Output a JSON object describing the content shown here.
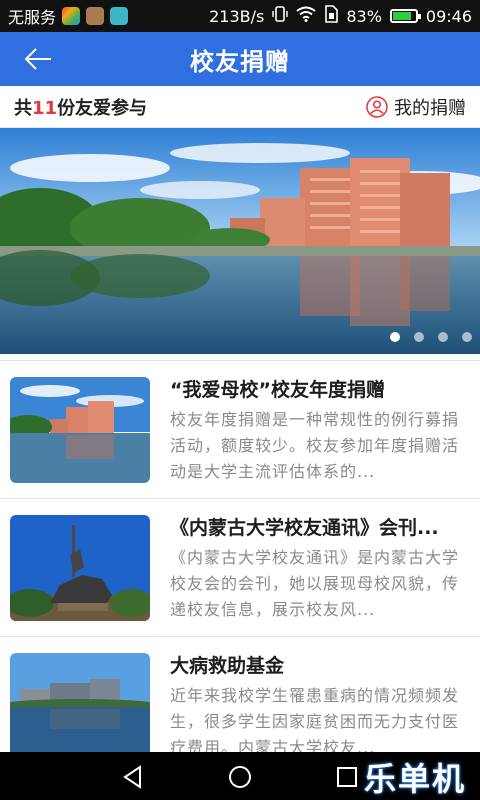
{
  "status_bar": {
    "carrier": "无服务",
    "speed": "213B/s",
    "battery_percent": "83%",
    "battery_level": 0.83,
    "time": "09:46"
  },
  "header": {
    "title": "校友捐赠",
    "back_icon": "arrow-left-icon"
  },
  "info_bar": {
    "prefix": "共",
    "count": "11",
    "suffix": "份友爱参与",
    "my_donation_label": "我的捐赠",
    "my_donation_icon": "user-icon"
  },
  "banner": {
    "slide_count": 4,
    "active_index": 0
  },
  "items": [
    {
      "title": "“我爱母校”校友年度捐赠",
      "desc": "校友年度捐赠是一种常规性的例行募捐活动，额度较少。校友参加年度捐赠活动是大学主流评估体系的..."
    },
    {
      "title": "《内蒙古大学校友通讯》会刊...",
      "desc": "《内蒙古大学校友通讯》是内蒙古大学校友会的会刊，她以展现母校风貌，传递校友信息，展示校友风..."
    },
    {
      "title": "大病救助基金",
      "desc": "近年来我校学生罹患重病的情况频频发生，很多学生因家庭贫困而无力支付医疗费用。内蒙古大学校友..."
    }
  ],
  "watermark": "乐单机",
  "colors": {
    "primary": "#2f6fe0",
    "accent_red": "#e0393e",
    "desc_gray": "#8a8a8a"
  }
}
